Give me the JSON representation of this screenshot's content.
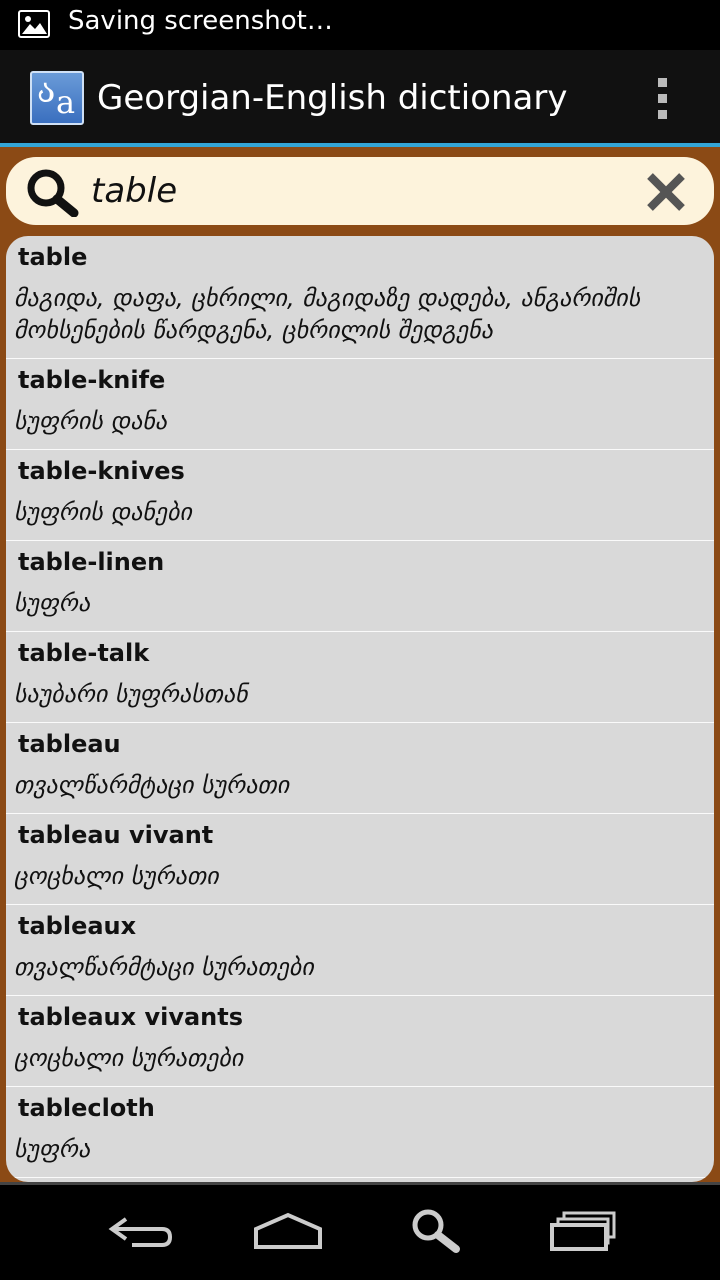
{
  "status_bar": {
    "notification_icon": "image-icon",
    "text": "Saving screenshot…"
  },
  "action_bar": {
    "logo_icon": "dictionary-logo-icon",
    "title": "Georgian-English dictionary",
    "menu_icon": "overflow-menu-icon"
  },
  "search": {
    "icon": "search-icon",
    "value": "table",
    "clear_icon": "close-icon"
  },
  "results": [
    {
      "word": "table",
      "translation": "მაგიდა, დაფა, ცხრილი, მაგიდაზე დადება, ანგარიშის მოხსენების წარდგენა, ცხრილის შედგენა"
    },
    {
      "word": "table-knife",
      "translation": "სუფრის დანა"
    },
    {
      "word": "table-knives",
      "translation": "სუფრის დანები"
    },
    {
      "word": "table-linen",
      "translation": "სუფრა"
    },
    {
      "word": "table-talk",
      "translation": "საუბარი სუფრასთან"
    },
    {
      "word": "tableau",
      "translation": "თვალწარმტაცი სურათი"
    },
    {
      "word": "tableau vivant",
      "translation": "ცოცხალი სურათი"
    },
    {
      "word": "tableaux",
      "translation": "თვალწარმტაცი სურათები"
    },
    {
      "word": "tableaux vivants",
      "translation": "ცოცხალი სურათები"
    },
    {
      "word": "tablecloth",
      "translation": "სუფრა"
    }
  ],
  "nav_bar": {
    "back_icon": "back-icon",
    "home_icon": "home-icon",
    "search_icon": "search-icon",
    "recents_icon": "recent-apps-icon"
  },
  "colors": {
    "accent": "#33a5d6",
    "background": "#8b4a15",
    "search_bg": "#fdf3dc",
    "list_bg": "#d9d9d9"
  }
}
